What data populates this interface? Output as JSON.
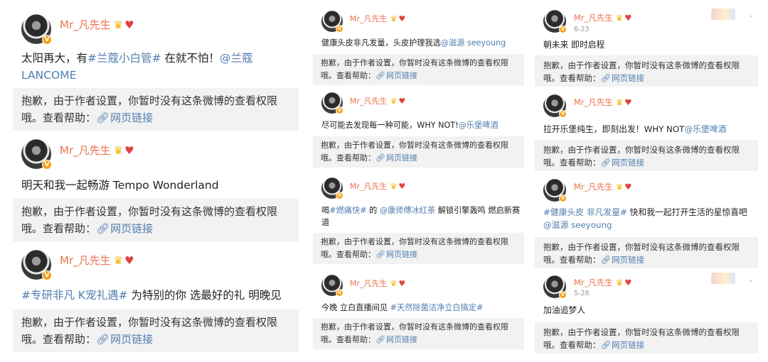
{
  "user": {
    "name": "Mr_凡先生",
    "crown_icon": "crown-icon",
    "heart_icon": "heart-icon",
    "verified_badge": "V"
  },
  "notice": {
    "line1": "抱歉，由于作者设置，你暂时没有这条微博的查看权限",
    "line2_prefix": "哦。查看帮助：",
    "link_icon": "link-icon",
    "link_text": "网页链接"
  },
  "colors": {
    "username": "#eb7350",
    "link": "#507daf",
    "notice_bg": "#f2f2f2",
    "badge": "#f7a21b"
  },
  "col_a": {
    "post1": {
      "text1": "太阳再大，有",
      "tag": "#兰蔻小白管#",
      "text2": " 在就不怕！",
      "mention": "@兰蔻LANCOME"
    },
    "post2": {
      "text1": "明天和我一起畅游 Tempo Wonderland"
    },
    "post3": {
      "tag": "#专研非凡 K宠礼遇#",
      "text2": " 为特别的你 选最好的礼 明晚见"
    }
  },
  "col_b": {
    "post1": {
      "text1": "健康头皮非凡发量，头皮护理我选",
      "mention": "@滋源 seeyoung"
    },
    "post2": {
      "text1": "尽可能去发现每一种可能，WHY NOT!",
      "mention": "@乐堡啤酒"
    },
    "post3": {
      "text1": "喝",
      "tag1": "#燃痛快#",
      "text2": " 的 ",
      "mention": "@康师傅冰红茶",
      "text3": " 解锁引擎轰鸣 燃启新赛道"
    },
    "post4": {
      "text1": "今晚 立白直播间见 ",
      "tag": "#天然除菌洁净立白搞定#"
    }
  },
  "col_c": {
    "post1": {
      "date": "6-23",
      "text1": "朝未来 即时启程"
    },
    "post2": {
      "text1": "拉开乐堡纯生，即刻出发！WHY NOT",
      "mention": "@乐堡啤酒"
    },
    "post3": {
      "tag": "#健康头皮 非凡发量#",
      "text2": " 快和我一起打开生活的星惊喜吧",
      "mention": "@滋源 seeyoung"
    },
    "post4": {
      "date": "5-28",
      "text1": "加油追梦人"
    }
  },
  "icons": {
    "caret": "chevron-down-icon",
    "sticker": "sticker-icon"
  }
}
